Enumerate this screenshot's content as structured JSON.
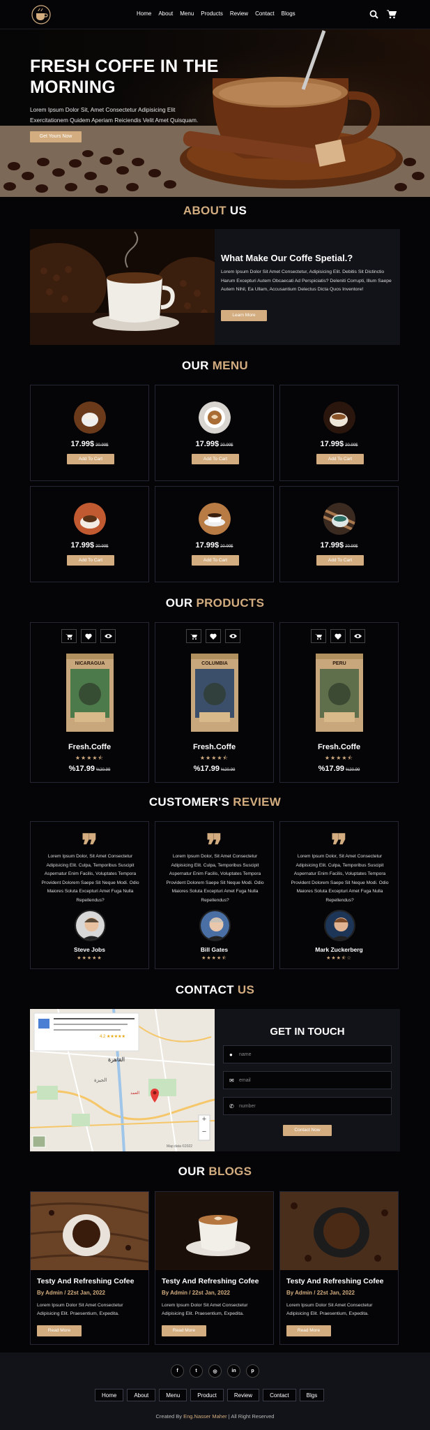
{
  "header": {
    "nav": [
      "Home",
      "About",
      "Menu",
      "Products",
      "Review",
      "Contact",
      "Blogs"
    ],
    "icons": [
      "search-icon",
      "cart-icon"
    ]
  },
  "hero": {
    "title": "FRESH COFFE IN THE MORNING",
    "description": "Lorem Ipsum Dolor Sit, Amet Consectetur Adipisicing Elit Exercitationem Quidem Aperiam Reiciendis Velit Amet Quisquam.",
    "cta": "Get Yours Now"
  },
  "about": {
    "title_a": "ABOUT",
    "title_b": "US",
    "heading": "What Make Our Coffe Spetial.?",
    "text": "Lorem Ipsum Dolor Sit Amet Consectetur, Adipisicing Elit. Debitis Sit Distinctio Harum Excepturi Autem Obcaecati Ad Perspiciatis? Deleniti Corrupti, Illum Saepe Autem Nihil, Ea Ullam, Accusantium Delectus Dicta Quos Inventore!",
    "button": "Learn More"
  },
  "menu": {
    "title_a": "OUR",
    "title_b": "MENU",
    "items": [
      {
        "price": "17.99$",
        "old": "20.99$",
        "button": "Add To Cart"
      },
      {
        "price": "17.99$",
        "old": "20.99$",
        "button": "Add To Cart"
      },
      {
        "price": "17.99$",
        "old": "20.99$",
        "button": "Add To Cart"
      },
      {
        "price": "17.99$",
        "old": "20.99$",
        "button": "Add To Cart"
      },
      {
        "price": "17.99$",
        "old": "20.99$",
        "button": "Add To Cart"
      },
      {
        "price": "17.99$",
        "old": "20.99$",
        "button": "Add To Cart"
      }
    ]
  },
  "products": {
    "title_a": "OUR",
    "title_b": "PRODUCTS",
    "items": [
      {
        "bag_label": "NICARAGUA",
        "name": "Fresh.Coffe",
        "stars": "★★★★⯪",
        "price": "%17.99",
        "old": "%20.99",
        "bag_color": "#4c7a4a"
      },
      {
        "bag_label": "COLUMBIA",
        "name": "Fresh.Coffe",
        "stars": "★★★★⯪",
        "price": "%17.99",
        "old": "%20.99",
        "bag_color": "#3b4e6a"
      },
      {
        "bag_label": "PERU",
        "name": "Fresh.Coffe",
        "stars": "★★★★⯪",
        "price": "%17.99",
        "old": "%20.99",
        "bag_color": "#5f6e4b"
      }
    ]
  },
  "review": {
    "title_a": "CUSTOMER'S",
    "title_b": "REVIEW",
    "items": [
      {
        "text": "Lorem Ipsum Dolor, Sit Amet Consectetur Adipisicing Elit. Culpa, Temporibus Suscipit Aspernatur Enim Facilis, Voluptates Tempora Provident Dolorem Saepe Sit Neque Modi. Odio Maiores Soluta Excepturi Amet Fuga Nulla Repellendus?",
        "name": "Steve Jobs",
        "stars": "★★★★★"
      },
      {
        "text": "Lorem Ipsum Dolor, Sit Amet Consectetur Adipisicing Elit. Culpa, Temporibus Suscipit Aspernatur Enim Facilis, Voluptates Tempora Provident Dolorem Saepe Sit Neque Modi. Odio Maiores Soluta Excepturi Amet Fuga Nulla Repellendus?",
        "name": "Bill Gates",
        "stars": "★★★★⯪"
      },
      {
        "text": "Lorem Ipsum Dolor, Sit Amet Consectetur Adipisicing Elit. Culpa, Temporibus Suscipit Aspernatur Enim Facilis, Voluptates Tempora Provident Dolorem Saepe Sit Neque Modi. Odio Maiores Soluta Excepturi Amet Fuga Nulla Repellendus?",
        "name": "Mark Zuckerberg",
        "stars": "★★★⯪☆"
      }
    ]
  },
  "contact": {
    "title_a": "CONTACT",
    "title_b": "US",
    "map": {
      "city_ar": "القاهرة",
      "giza_ar": "الجيزة",
      "marker_ar": "العمد",
      "rating": "4.2 ★★★★★",
      "zoom_in": "+",
      "zoom_out": "−",
      "attribution": "Map data ©2022"
    },
    "form": {
      "heading": "GET IN TOUCH",
      "name_placeholder": "name",
      "email_placeholder": "email",
      "number_placeholder": "number",
      "button": "Contact Now"
    }
  },
  "blogs": {
    "title_a": "OUR",
    "title_b": "BLOGS",
    "items": [
      {
        "title": "Testy And Refreshing Cofee",
        "meta": "By Admin / 22st Jan, 2022",
        "text": "Lorem Ipsum Dolor Sit Amet Consectetur Adipisicing Elit. Praesentium, Expedita.",
        "button": "Read More"
      },
      {
        "title": "Testy And Refreshing Cofee",
        "meta": "By Admin / 22st Jan, 2022",
        "text": "Lorem Ipsum Dolor Sit Amet Consectetur Adipisicing Elit. Praesentium, Expedita.",
        "button": "Read More"
      },
      {
        "title": "Testy And Refreshing Cofee",
        "meta": "By Admin / 22st Jan, 2022",
        "text": "Lorem Ipsum Dolor Sit Amet Consectetur Adipisicing Elit. Praesentium, Expedita.",
        "button": "Read More"
      }
    ]
  },
  "footer": {
    "social": [
      "f",
      "t",
      "◎",
      "in",
      "p"
    ],
    "nav": [
      "Home",
      "About",
      "Menu",
      "Product",
      "Review",
      "Contact",
      "Blgs"
    ],
    "credit_pre": "Created By ",
    "credit_name": "Eng.Nasser Maher",
    "credit_post": " | All Right Reserved"
  },
  "colors": {
    "accent": "#d3ad7f",
    "background": "#050508",
    "card_border": "#242733",
    "panel": "#121318"
  }
}
